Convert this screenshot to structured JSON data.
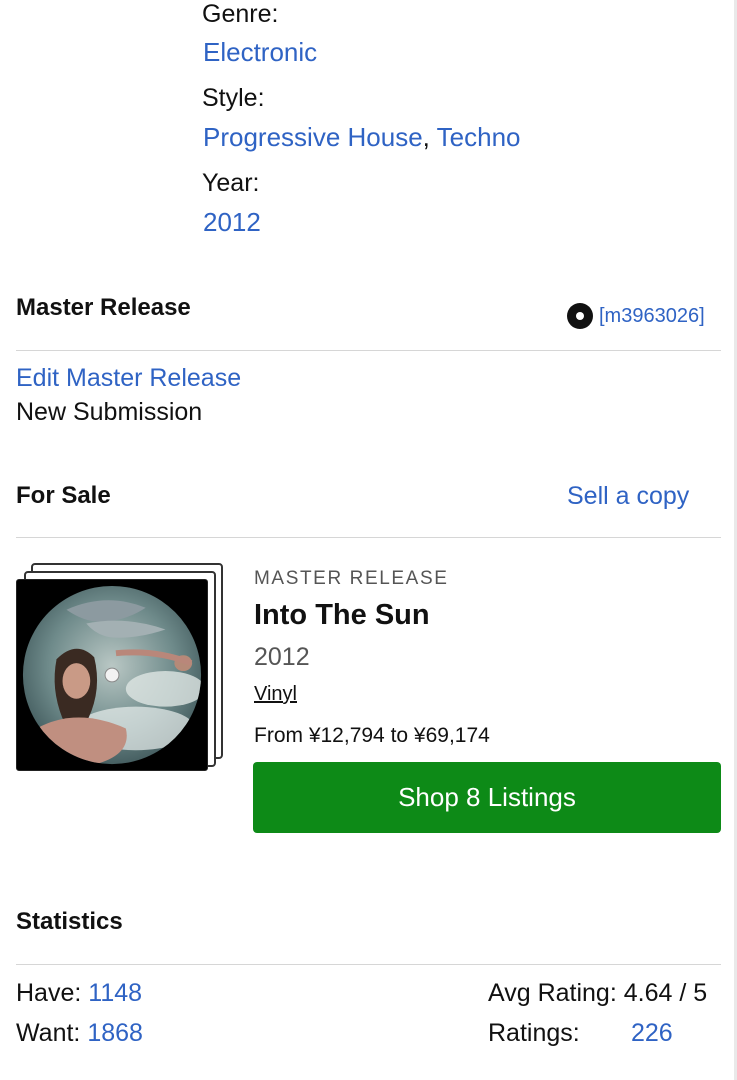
{
  "details": {
    "genre_label": "Genre:",
    "genre_value": "Electronic",
    "style_label": "Style:",
    "style_values": [
      "Progressive House",
      "Techno"
    ],
    "style_separator": ",",
    "year_label": "Year:",
    "year_value": "2012"
  },
  "master": {
    "heading": "Master Release",
    "id": "[m3963026]",
    "edit_link": "Edit Master Release",
    "new_submission": "New Submission"
  },
  "for_sale": {
    "heading": "For Sale",
    "sell_link": "Sell a copy",
    "item": {
      "kicker": "MASTER RELEASE",
      "title": "Into The Sun",
      "year": "2012",
      "format": "Vinyl",
      "price_range": "From ¥12,794 to ¥69,174",
      "shop_button": "Shop 8 Listings"
    }
  },
  "statistics": {
    "heading": "Statistics",
    "have_label": "Have:",
    "have_value": "1148",
    "want_label": "Want:",
    "want_value": "1868",
    "avg_rating_label": "Avg Rating:",
    "avg_rating_value": "4.64 / 5",
    "ratings_label": "Ratings:",
    "ratings_value": "226"
  },
  "colors": {
    "link": "#2f63c4",
    "button_green": "#0d8a17",
    "divider": "#d6d6d6"
  },
  "icons": {
    "master_id_icon": "vinyl-disc-icon"
  }
}
